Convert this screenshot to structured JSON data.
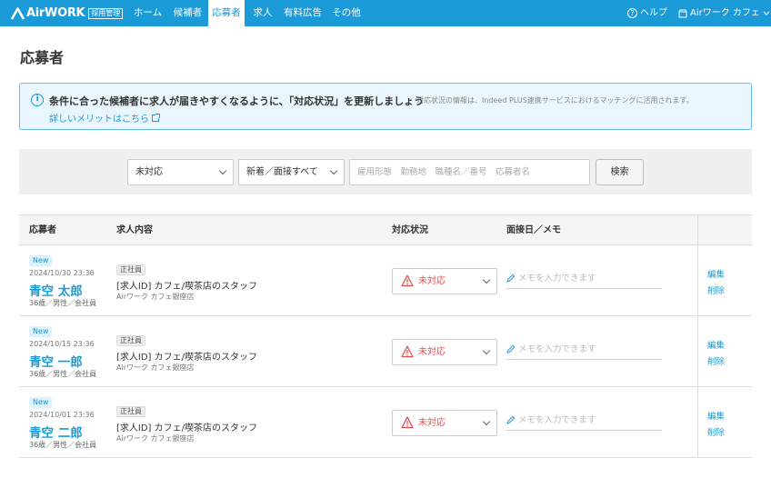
{
  "nav": {
    "logo_text": "AirWORK",
    "logo_badge": "採用管理",
    "items": [
      {
        "label": "ホーム"
      },
      {
        "label": "候補者"
      },
      {
        "label": "応募者"
      },
      {
        "label": "求人"
      },
      {
        "label": "有料広告"
      },
      {
        "label": "その他"
      }
    ],
    "active_item": "応募者",
    "help_label": "ヘルプ",
    "account_label": "Airワーク カフェ"
  },
  "page_title": "応募者",
  "banner": {
    "main_text": "条件に合った候補者に求人が届きやすくなるように、「対応状況」を更新しましょう",
    "sub_text": "対応状況の情報は、Indeed PLUS連携サービスにおけるマッチングに活用されます。",
    "link_text": "詳しいメリットはこちら"
  },
  "filters": {
    "status_selected": "未対応",
    "type_selected": "新着／面接すべて",
    "search_placeholder": "雇用形態　勤務地　職種名／番号　応募者名",
    "search_button": "検索"
  },
  "table": {
    "headers": {
      "applicant": "応募者",
      "job": "求人内容",
      "status": "対応状況",
      "memo": "面接日／メモ"
    },
    "rows": [
      {
        "badge": "New",
        "date": "2024/10/30 23:36",
        "name": "青空 太郎",
        "attrs": "36歳／男性／会社員",
        "tag": "正社員",
        "job_title": "[求人ID] カフェ/喫茶店のスタッフ",
        "store": "Airワーク カフェ銀座店",
        "status": "未対応",
        "memo_placeholder": "メモを入力できます",
        "edit": "編集",
        "delete": "削除"
      },
      {
        "badge": "New",
        "date": "2024/10/15 23:36",
        "name": "青空 一郎",
        "attrs": "36歳／男性／会社員",
        "tag": "正社員",
        "job_title": "[求人ID] カフェ/喫茶店のスタッフ",
        "store": "Airワーク カフェ銀座店",
        "status": "未対応",
        "memo_placeholder": "メモを入力できます",
        "edit": "編集",
        "delete": "削除"
      },
      {
        "badge": "New",
        "date": "2024/10/01 23:36",
        "name": "青空 二郎",
        "attrs": "36歳／男性／会社員",
        "tag": "正社員",
        "job_title": "[求人ID] カフェ/喫茶店のスタッフ",
        "store": "Airワーク カフェ銀座店",
        "status": "未対応",
        "memo_placeholder": "メモを入力できます",
        "edit": "編集",
        "delete": "削除"
      }
    ]
  },
  "colors": {
    "brand": "#1a9bd8",
    "status_warning": "#e05050",
    "banner_bg": "#eaf6fd"
  }
}
